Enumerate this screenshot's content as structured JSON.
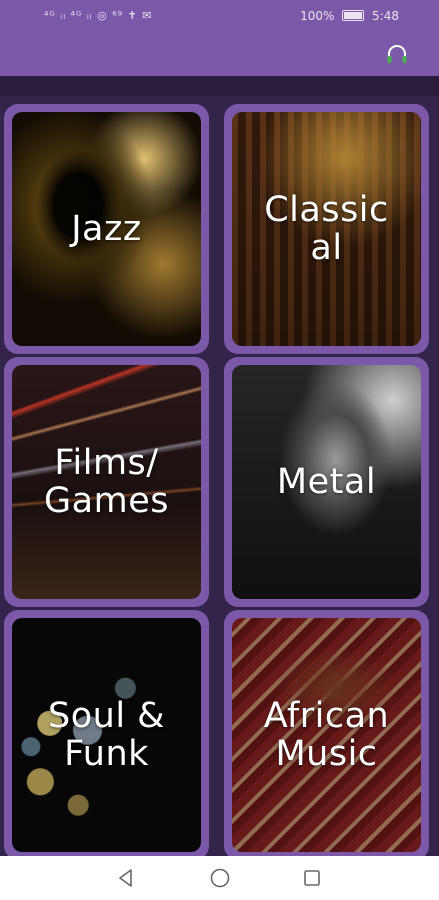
{
  "status_bar": {
    "left": "ᵀᵀ ‡ ‡ ‡ ‡",
    "battery_percent": "100%",
    "time": "5:48"
  },
  "app_bar": {
    "icon": "headphones-icon",
    "accent_color": "#7b59a8"
  },
  "genres": [
    {
      "label": "Jazz"
    },
    {
      "label": "Classic\nal"
    },
    {
      "label": "Films/\nGames"
    },
    {
      "label": "Metal"
    },
    {
      "label": "Soul &\nFunk"
    },
    {
      "label": "African\nMusic"
    }
  ],
  "nav": {
    "back_icon": "back-triangle-icon",
    "home_icon": "home-circle-icon",
    "recents_icon": "recents-square-icon"
  }
}
